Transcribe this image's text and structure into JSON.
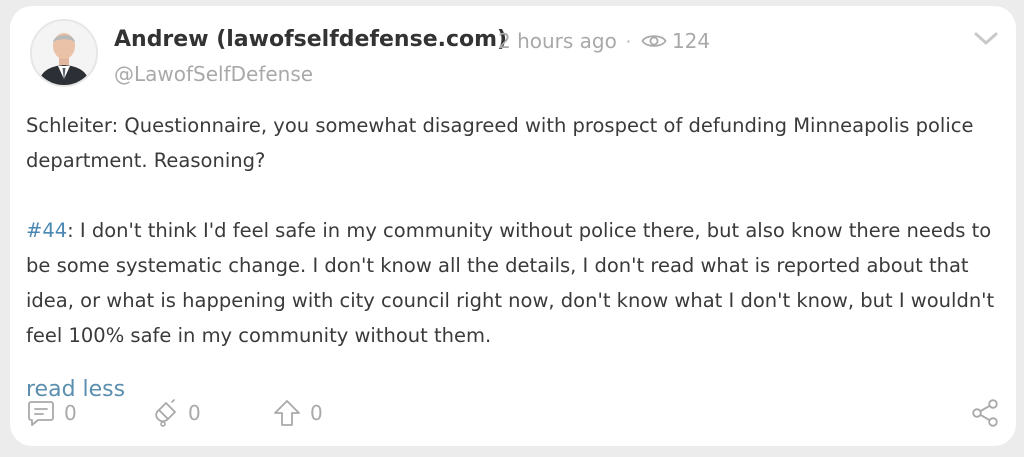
{
  "post": {
    "author_name": "Andrew (lawofselfdefense.com)",
    "time_ago": "2 hours ago",
    "separator": "·",
    "view_count": "124",
    "handle": "@LawofSelfDefense",
    "paragraph1": "Schleiter: Questionnaire, you somewhat disagreed with prospect of defunding Minneapolis police department. Reasoning?",
    "hashtag": "#44",
    "paragraph2_rest": ": I don't think I'd feel safe in my community without police there, but also know there needs to be some systematic change. I don't know all the details, I don't read what is reported about that idea, or what is happening with city council right now, don't know what I don't know, but I wouldn't feel 100% safe in my community without them.",
    "read_less_label": "read less"
  },
  "actions": {
    "comments_count": "0",
    "tips_count": "0",
    "upvotes_count": "0"
  },
  "icons": {
    "views": "eye-icon",
    "menu": "chevron-down-icon",
    "comments": "comment-icon",
    "tip": "tip-icon",
    "upvote": "upvote-arrow-icon",
    "share": "share-icon"
  },
  "colors": {
    "accent_link": "#4a88b3",
    "muted_text": "#a9a9a9",
    "body_text": "#3a3a3a",
    "author_text": "#333333"
  }
}
